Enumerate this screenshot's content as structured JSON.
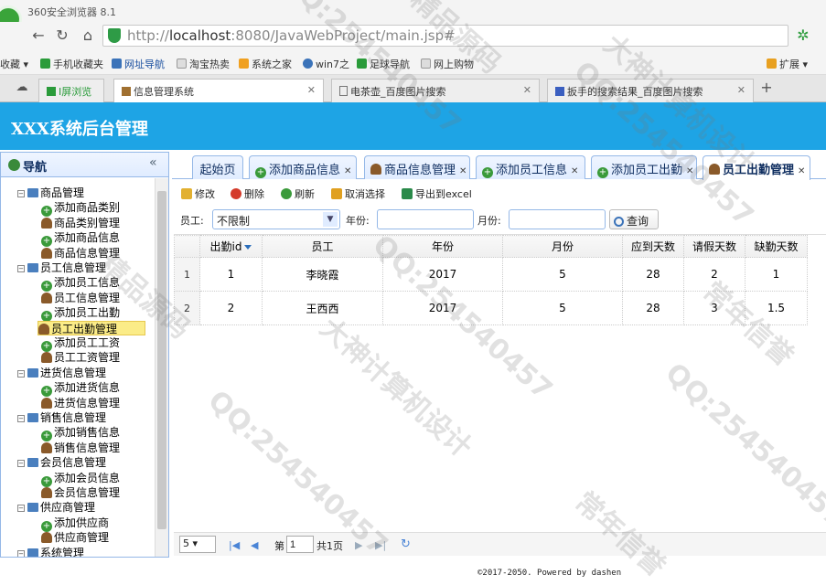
{
  "browser": {
    "title": "360安全浏览器 8.1",
    "url_prefix": "http://",
    "url_host": "localhost",
    "url_rest": ":8080/JavaWebProject/main.jsp#",
    "bookmarks": [
      "收藏",
      "手机收藏夹",
      "网址导航",
      "淘宝热卖",
      "系统之家",
      "win7之",
      "足球导航",
      "网上购物",
      "扩展"
    ],
    "tabs": [
      {
        "label": "I屏浏览"
      },
      {
        "label": "信息管理系统"
      },
      {
        "label": "电茶壶_百度图片搜索"
      },
      {
        "label": "扳手的搜索结果_百度图片搜索"
      }
    ],
    "new_tab": "+",
    "colors": {
      "accent": "#1ea4e5"
    }
  },
  "app": {
    "title": "XXX系统后台管理"
  },
  "sidebar": {
    "title": "导航",
    "collapse": "«",
    "tree": [
      {
        "label": "商品管理",
        "type": "folder"
      },
      {
        "label": "添加商品类别",
        "type": "add"
      },
      {
        "label": "商品类别管理",
        "type": "person"
      },
      {
        "label": "添加商品信息",
        "type": "add"
      },
      {
        "label": "商品信息管理",
        "type": "person"
      },
      {
        "label": "员工信息管理",
        "type": "folder"
      },
      {
        "label": "添加员工信息",
        "type": "add"
      },
      {
        "label": "员工信息管理",
        "type": "person"
      },
      {
        "label": "添加员工出勤",
        "type": "add"
      },
      {
        "label": "员工出勤管理",
        "type": "person",
        "selected": true
      },
      {
        "label": "添加员工工资",
        "type": "add"
      },
      {
        "label": "员工工资管理",
        "type": "person"
      },
      {
        "label": "进货信息管理",
        "type": "folder"
      },
      {
        "label": "添加进货信息",
        "type": "add"
      },
      {
        "label": "进货信息管理",
        "type": "person"
      },
      {
        "label": "销售信息管理",
        "type": "folder"
      },
      {
        "label": "添加销售信息",
        "type": "add"
      },
      {
        "label": "销售信息管理",
        "type": "person"
      },
      {
        "label": "会员信息管理",
        "type": "folder"
      },
      {
        "label": "添加会员信息",
        "type": "add"
      },
      {
        "label": "会员信息管理",
        "type": "person"
      },
      {
        "label": "供应商管理",
        "type": "folder"
      },
      {
        "label": "添加供应商",
        "type": "add"
      },
      {
        "label": "供应商管理",
        "type": "person"
      },
      {
        "label": "系统管理",
        "type": "folder"
      }
    ]
  },
  "content_tabs": [
    {
      "label": "起始页",
      "icon": "none"
    },
    {
      "label": "添加商品信息",
      "icon": "add"
    },
    {
      "label": "商品信息管理",
      "icon": "person"
    },
    {
      "label": "添加员工信息",
      "icon": "add"
    },
    {
      "label": "添加员工出勤",
      "icon": "add"
    },
    {
      "label": "员工出勤管理",
      "icon": "person",
      "active": true
    }
  ],
  "toolbar": {
    "edit": "修改",
    "delete": "删除",
    "refresh": "刷新",
    "cancel_select": "取消选择",
    "export": "导出到excel"
  },
  "search": {
    "employee_label": "员工:",
    "employee_value": "不限制",
    "year_label": "年份:",
    "year_value": "",
    "month_label": "月份:",
    "month_value": "",
    "query_label": "查询"
  },
  "grid": {
    "columns": [
      "出勤id",
      "员工",
      "年份",
      "月份",
      "应到天数",
      "请假天数",
      "缺勤天数"
    ],
    "rows": [
      {
        "rownum": "1",
        "id": "1",
        "employee": "李晓霞",
        "year": "2017",
        "month": "5",
        "due": "28",
        "leave": "2",
        "absent": "1"
      },
      {
        "rownum": "2",
        "id": "2",
        "employee": "王西西",
        "year": "2017",
        "month": "5",
        "due": "28",
        "leave": "3",
        "absent": "1.5"
      }
    ]
  },
  "pager": {
    "page_size": "5",
    "page_label": "第",
    "page_value": "1",
    "total_label": "共1页"
  },
  "footer": "©2017-2050. Powered by dashen",
  "watermarks": [
    "QQ:254540457",
    "大神计算机设计",
    "常年信誉",
    "精品源码"
  ]
}
